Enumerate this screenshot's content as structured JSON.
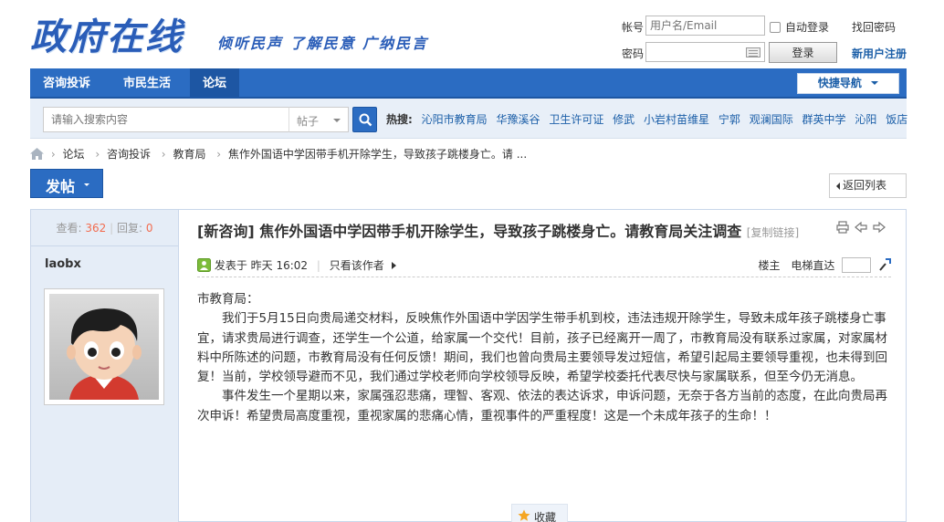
{
  "header": {
    "logo": "政府在线",
    "slogan": "倾听民声 了解民意 广纳民言"
  },
  "login": {
    "account_label": "帐号",
    "account_placeholder": "用户名/Email",
    "auto_login_label": "自动登录",
    "forgot_password": "找回密码",
    "password_label": "密码",
    "login_button": "登录",
    "register": "新用户注册"
  },
  "nav": {
    "items": [
      {
        "label": "咨询投诉"
      },
      {
        "label": "市民生活"
      },
      {
        "label": "论坛"
      }
    ],
    "quick_nav": "快捷导航"
  },
  "search": {
    "placeholder": "请输入搜索内容",
    "type": "帖子",
    "hot_label": "热搜:",
    "hot_words": [
      "沁阳市教育局",
      "华豫溪谷",
      "卫生许可证",
      "修武",
      "小岩村苗维星",
      "宁郭",
      "观澜国际",
      "群英中学",
      "沁阳",
      "饭店"
    ]
  },
  "breadcrumb": [
    "论坛",
    "咨询投诉",
    "教育局",
    "焦作外国语中学因带手机开除学生，导致孩子跳楼身亡。请 ..."
  ],
  "actions": {
    "post_button": "发帖",
    "back_button": "返回列表"
  },
  "thread": {
    "views_label": "查看:",
    "views": "362",
    "replies_label": "回复:",
    "replies": "0",
    "author": "laobx",
    "title": "[新咨询] 焦作外国语中学因带手机开除学生，导致孩子跳楼身亡。请教育局关注调查",
    "copy_link": "[复制链接]",
    "posted_label": "发表于",
    "posted_time": "昨天 16:02",
    "only_author": "只看该作者",
    "floor_label": "楼主",
    "jump_label": "电梯直达",
    "body": {
      "salutation": "市教育局：",
      "p1": "我们于5月15日向贵局递交材料，反映焦作外国语中学因学生带手机到校，违法违规开除学生，导致未成年孩子跳楼身亡事宜，请求贵局进行调查，还学生一个公道，给家属一个交代！目前，孩子已经离开一周了，市教育局没有联系过家属，对家属材料中所陈述的问题，市教育局没有任何反馈！期间，我们也曾向贵局主要领导发过短信，希望引起局主要领导重视，也未得到回复！当前，学校领导避而不见，我们通过学校老师向学校领导反映，希望学校委托代表尽快与家属联系，但至今仍无消息。",
      "p2": "事件发生一个星期以来，家属强忍悲痛，理智、客观、依法的表达诉求，申诉问题，无奈于各方当前的态度，在此向贵局再次申诉！希望贵局高度重视，重视家属的悲痛心情，重视事件的严重程度！这是一个未成年孩子的生命！！"
    },
    "favorite_button": "收藏"
  }
}
